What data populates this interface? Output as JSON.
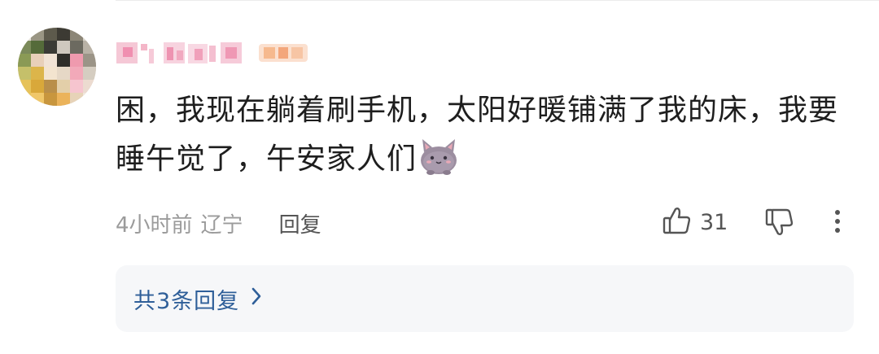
{
  "comment": {
    "text_line1": "困，我现在躺着刷手机，太阳好暖铺满了我的床，我要",
    "text_line2": "睡午觉了，午安家人们",
    "emoji": "cat-emoji"
  },
  "meta": {
    "time": "4小时前",
    "location": "辽宁",
    "reply_label": "回复"
  },
  "actions": {
    "like_count": "31",
    "like_icon": "thumbs-up-icon",
    "dislike_icon": "thumbs-down-icon",
    "more_icon": "more-vertical-icon"
  },
  "replies": {
    "label": "共3条回复",
    "chevron_icon": "chevron-right-icon"
  },
  "colors": {
    "text": "#1e1e1e",
    "meta": "#9b9b9b",
    "link": "#2f5f99",
    "replies_bg": "#f6f7f9"
  }
}
